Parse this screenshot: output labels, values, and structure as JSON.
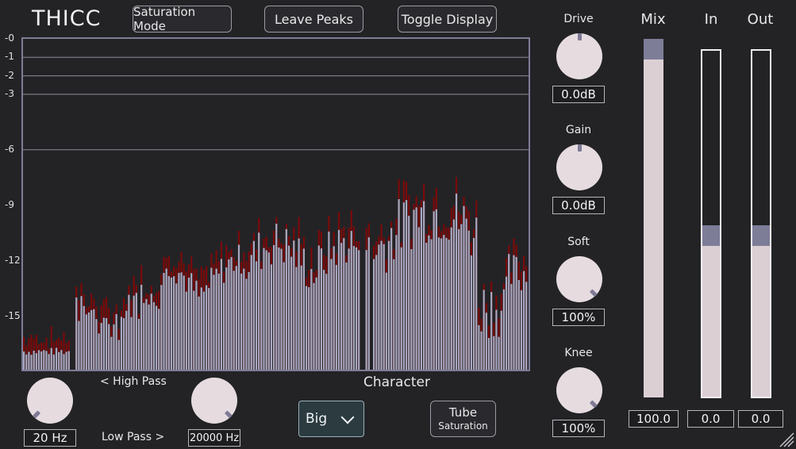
{
  "app": {
    "title": "THICC"
  },
  "toolbar": {
    "saturation_mode": "Saturation Mode",
    "leave_peaks": "Leave Peaks",
    "toggle_display": "Toggle Display"
  },
  "spectrum": {
    "y_ticks": [
      {
        "label": "-0",
        "db": 0
      },
      {
        "label": "-1",
        "db": -1
      },
      {
        "label": "-2",
        "db": -2
      },
      {
        "label": "-3",
        "db": -3
      },
      {
        "label": "-6",
        "db": -6
      },
      {
        "label": "-9",
        "db": -9
      },
      {
        "label": "-12",
        "db": -12
      },
      {
        "label": "-15",
        "db": -15
      }
    ],
    "range_db": [
      -18,
      0
    ],
    "grid_db": [
      -1,
      -2,
      -3,
      -6
    ],
    "colors": {
      "bar": "#a8a8c0",
      "peak": "#7a0a0a",
      "grid": "#8c8c98",
      "border": "#7d7d98"
    }
  },
  "filters": {
    "high_pass_label": "< High Pass",
    "high_pass_value": "20 Hz",
    "high_pass_fraction": 0.0,
    "low_pass_label": "Low Pass >",
    "low_pass_value": "20000 Hz",
    "low_pass_fraction": 1.0
  },
  "character": {
    "label": "Character",
    "selected": "Big",
    "mode_button_line1": "Tube",
    "mode_button_line2": "Saturation"
  },
  "knobs": {
    "drive": {
      "label": "Drive",
      "value": "0.0dB",
      "fraction": 0.5
    },
    "gain": {
      "label": "Gain",
      "value": "0.0dB",
      "fraction": 0.5
    },
    "soft": {
      "label": "Soft",
      "value": "100%",
      "fraction": 1.0
    },
    "knee": {
      "label": "Knee",
      "value": "100%",
      "fraction": 1.0
    }
  },
  "meters": {
    "mix": {
      "label": "Mix",
      "value": "100.0",
      "fraction": 1.0
    },
    "in": {
      "label": "In",
      "value": "0.0",
      "fraction": 0.5
    },
    "out": {
      "label": "Out",
      "value": "0.0",
      "fraction": 0.5
    }
  },
  "colors": {
    "background": "#232326",
    "knob": "#e6dce0",
    "handle": "#7e7d98",
    "accent_teal": "#2b3b40"
  }
}
